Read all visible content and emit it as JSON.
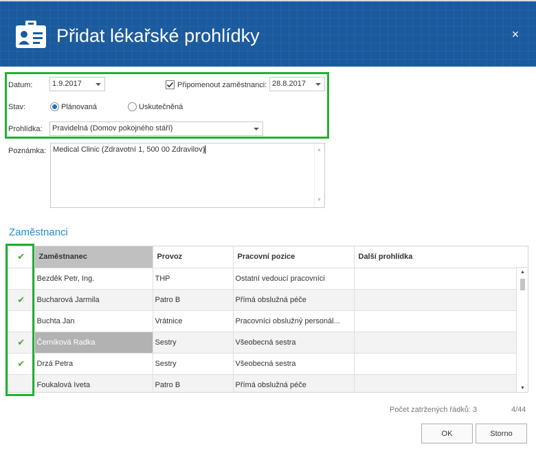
{
  "dialog": {
    "title": "Přidat lékařské prohlídky",
    "close_label": "×",
    "title_icon": "id-card-icon"
  },
  "form": {
    "date_label": "Datum:",
    "date_value": "1.9.2017",
    "remind_label": "Připomenout zaměstnanci:",
    "remind_checked": true,
    "remind_date": "28.8.2017",
    "state_label": "Stav:",
    "state_planned": "Plánovaná",
    "state_done": "Uskutečněná",
    "state_selected": "Plánovaná",
    "exam_label": "Prohlídka:",
    "exam_value": "Pravidelná (Domov pokojného stáří)",
    "note_label": "Poznámka:",
    "note_value": "Medical Clinic (Zdravotní 1, 500 00 Zdravilov)"
  },
  "employees": {
    "section_title": "Zaměstnanci",
    "columns": {
      "check": "✔",
      "employee": "Zaměstnanec",
      "unit": "Provoz",
      "position": "Pracovní pozice",
      "next_exam": "Další prohlídka"
    },
    "rows": [
      {
        "checked": false,
        "check_mark": "",
        "employee": "Bezděk Petr, Ing.",
        "unit": "THP",
        "position": "Ostatní vedoucí pracovníci",
        "next_exam": ""
      },
      {
        "checked": true,
        "check_mark": "✔",
        "employee": "Bucharová Jarmila",
        "unit": "Patro B",
        "position": "Přímá obslužná péče",
        "next_exam": ""
      },
      {
        "checked": false,
        "check_mark": "",
        "employee": "Buchta Jan",
        "unit": "Vrátnice",
        "position": "Pracovníci obslužný personál...",
        "next_exam": ""
      },
      {
        "checked": true,
        "check_mark": "✔",
        "employee": "Černíková Radka",
        "unit": "Sestry",
        "position": "Všeobecná sestra",
        "next_exam": ""
      },
      {
        "checked": true,
        "check_mark": "✔",
        "employee": "Drzá Petra",
        "unit": "Sestry",
        "position": "Všeobecná sestra",
        "next_exam": ""
      },
      {
        "checked": false,
        "check_mark": "",
        "employee": "Foukalová Iveta",
        "unit": "Patro B",
        "position": "Přímá obslužná péče",
        "next_exam": ""
      }
    ],
    "checked_count_text": "Počet zatržených řádků: 3",
    "page_info": "4/44"
  },
  "buttons": {
    "ok": "OK",
    "cancel": "Storno"
  },
  "colors": {
    "title_bar": "#1a5a9e",
    "highlight_frame": "#21b02f",
    "section_title": "#1f8dd6",
    "check_mark": "#3fae2a",
    "radio_selected": "#1e74c8"
  }
}
